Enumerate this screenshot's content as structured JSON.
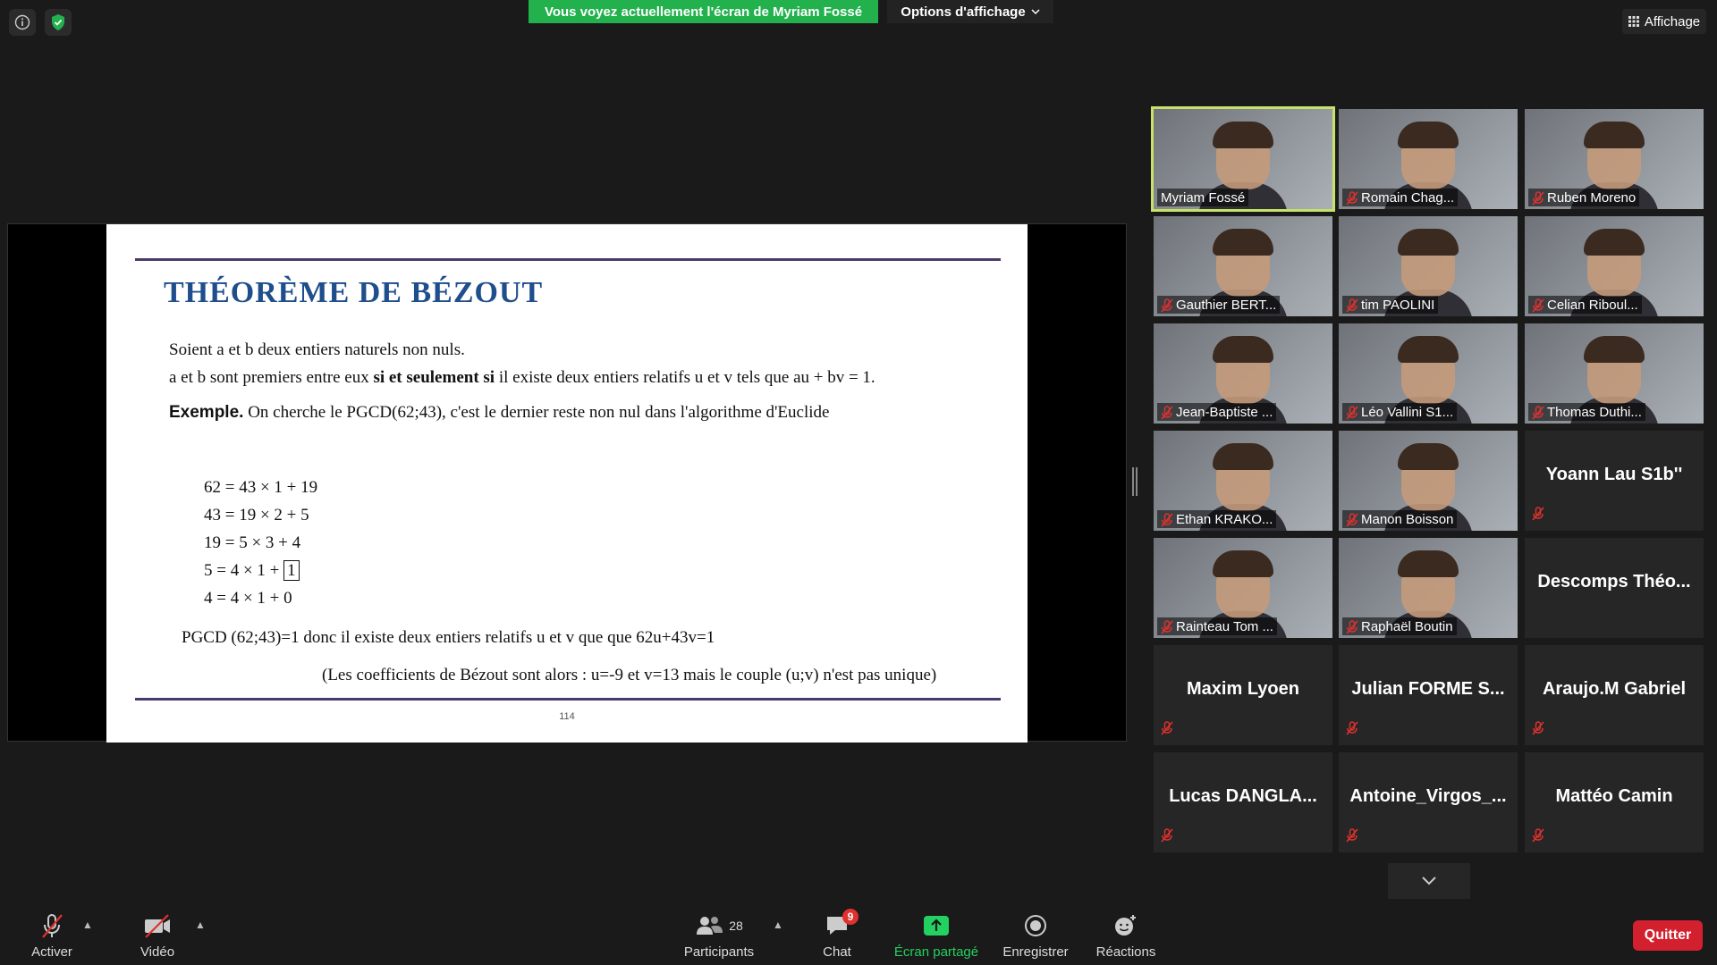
{
  "top": {
    "share_banner": "Vous voyez actuellement l'écran de Myriam Fossé",
    "view_options": "Options d'affichage",
    "view_button": "Affichage"
  },
  "slide": {
    "title": "THÉORÈME DE BÉZOUT",
    "line1": "Soient a et b deux entiers naturels non nuls.",
    "line2_a": "a et b sont premiers entre eux ",
    "line2_b": "si et seulement si",
    "line2_c": " il existe deux entiers relatifs u et v tels que au + bv = 1.",
    "example_label": "Exemple.",
    "example_text": " On cherche le PGCD(62;43), c'est le dernier reste non nul dans l'algorithme d'Euclide",
    "eq1": "62 = 43 × 1 + 19",
    "eq2": "43 = 19 × 2 + 5",
    "eq3": "19 = 5 × 3 + 4",
    "eq4_a": "5 = 4 × 1 +",
    "eq4_box": "1",
    "eq5": "4 = 4 × 1 + 0",
    "conclusion": "PGCD (62;43)=1 donc il existe deux entiers relatifs u et v que que 62u+43v=1",
    "note": "(Les coefficients de Bézout sont alors : u=-9 et v=13 mais le couple (u;v) n'est pas unique)",
    "page": "114"
  },
  "participants": [
    {
      "name": "Myriam Fossé",
      "video": true,
      "muted": false
    },
    {
      "name": "Romain Chag...",
      "video": true,
      "muted": true
    },
    {
      "name": "Ruben Moreno",
      "video": true,
      "muted": true
    },
    {
      "name": "Gauthier BERT...",
      "video": true,
      "muted": true
    },
    {
      "name": "tim PAOLINI",
      "video": true,
      "muted": true
    },
    {
      "name": "Celian Riboul...",
      "video": true,
      "muted": true
    },
    {
      "name": "Jean-Baptiste ...",
      "video": true,
      "muted": true
    },
    {
      "name": "Léo Vallini S1...",
      "video": true,
      "muted": true
    },
    {
      "name": "Thomas Duthi...",
      "video": true,
      "muted": true
    },
    {
      "name": "Ethan KRAKO...",
      "video": true,
      "muted": true
    },
    {
      "name": "Manon Boisson",
      "video": true,
      "muted": true
    },
    {
      "name": "Yoann Lau S1b''",
      "video": false,
      "muted": true
    },
    {
      "name": "Rainteau Tom ...",
      "video": true,
      "muted": true
    },
    {
      "name": "Raphaël Boutin",
      "video": true,
      "muted": true
    },
    {
      "name": "Descomps  Théo...",
      "video": false,
      "muted": false
    },
    {
      "name": "Maxim Lyoen",
      "video": false,
      "muted": true
    },
    {
      "name": "Julian  FORME  S...",
      "video": false,
      "muted": true
    },
    {
      "name": "Araujo.M Gabriel",
      "video": false,
      "muted": true
    },
    {
      "name": "Lucas  DANGLA...",
      "video": false,
      "muted": true
    },
    {
      "name": "Antoine_Virgos_...",
      "video": false,
      "muted": true
    },
    {
      "name": "Mattéo Camin",
      "video": false,
      "muted": true
    }
  ],
  "toolbar": {
    "mute_label": "Activer",
    "video_label": "Vidéo",
    "participants_label": "Participants",
    "participants_count": "28",
    "chat_label": "Chat",
    "chat_badge": "9",
    "share_label": "Écran partagé",
    "record_label": "Enregistrer",
    "reactions_label": "Réactions",
    "quit_label": "Quitter"
  },
  "colors": {
    "share_green": "#23b14d",
    "active_speaker": "#c7e26a",
    "quit_red": "#d3202e",
    "slide_title_blue": "#1f4e8c"
  }
}
